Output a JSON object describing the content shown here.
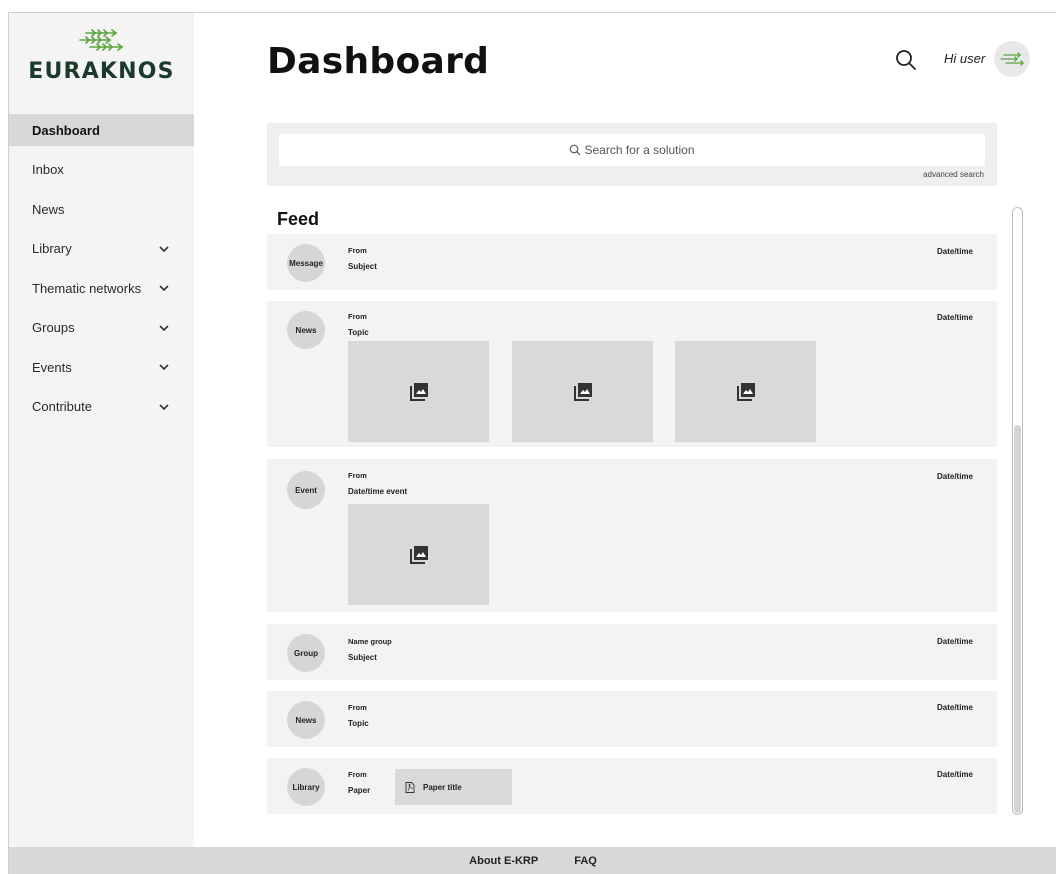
{
  "brand": {
    "name": "EURAKNOS",
    "logo_icon": "leaf-arrows-icon",
    "accent_color": "#5aa43f"
  },
  "sidebar": {
    "items": [
      {
        "label": "Dashboard",
        "active": true
      },
      {
        "label": "Inbox"
      },
      {
        "label": "News"
      },
      {
        "label": "Library",
        "expandable": true
      },
      {
        "label": "Thematic networks",
        "expandable": true
      },
      {
        "label": "Groups",
        "expandable": true
      },
      {
        "label": "Events",
        "expandable": true
      },
      {
        "label": "Contribute",
        "expandable": true
      }
    ]
  },
  "header": {
    "title": "Dashboard",
    "greeting": "Hi user",
    "search_icon": "search-icon"
  },
  "search": {
    "placeholder": "Search for a solution",
    "advanced_label": "advanced search"
  },
  "feed": {
    "title": "Feed",
    "items": [
      {
        "type": "Message",
        "line1": "From",
        "line2": "Subject",
        "datetime": "Date/time"
      },
      {
        "type": "News",
        "line1": "From",
        "line2": "Topic",
        "datetime": "Date/time",
        "images": 3
      },
      {
        "type": "Event",
        "line1": "From",
        "line2": "Date/time event",
        "datetime": "Date/time",
        "images": 1
      },
      {
        "type": "Group",
        "line1": "Name group",
        "line2": "Subject",
        "datetime": "Date/time"
      },
      {
        "type": "News",
        "line1": "From",
        "line2": "Topic",
        "datetime": "Date/time"
      },
      {
        "type": "Library",
        "line1": "From",
        "line2": "Paper",
        "datetime": "Date/time",
        "paper_title": "Paper title"
      }
    ]
  },
  "footer": {
    "links": [
      "About E-KRP",
      "FAQ"
    ]
  }
}
